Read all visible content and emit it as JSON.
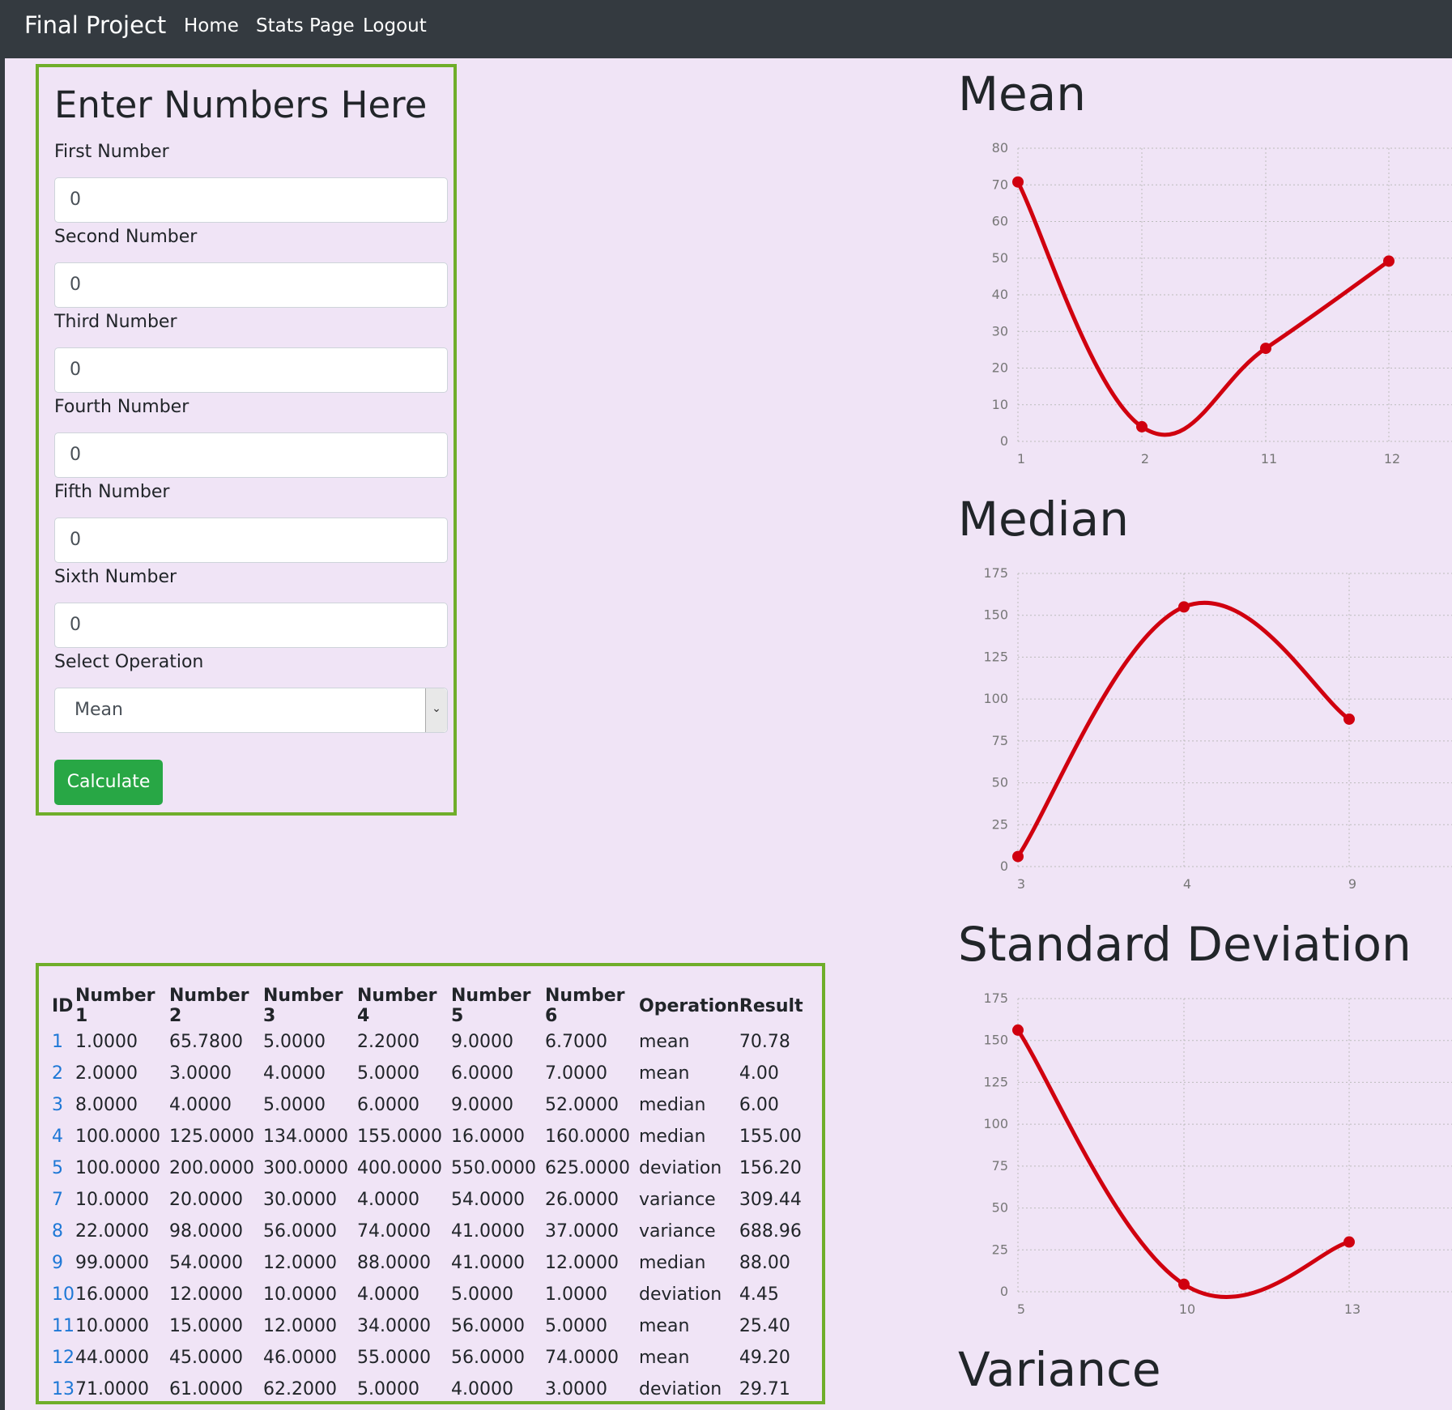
{
  "navbar": {
    "brand": "Final Project",
    "links": [
      "Home",
      "Stats Page",
      "Logout"
    ]
  },
  "form": {
    "title": "Enter Numbers Here",
    "fields": [
      {
        "label": "First Number",
        "value": "0"
      },
      {
        "label": "Second Number",
        "value": "0"
      },
      {
        "label": "Third Number",
        "value": "0"
      },
      {
        "label": "Fourth Number",
        "value": "0"
      },
      {
        "label": "Fifth Number",
        "value": "0"
      },
      {
        "label": "Sixth Number",
        "value": "0"
      }
    ],
    "operation_label": "Select Operation",
    "operation_value": "Mean",
    "submit_label": "Calculate"
  },
  "table": {
    "headers": [
      "ID",
      "Number 1",
      "Number 2",
      "Number 3",
      "Number 4",
      "Number 5",
      "Number 6",
      "Operation",
      "Result"
    ],
    "rows": [
      [
        "1",
        "1.0000",
        "65.7800",
        "5.0000",
        "2.2000",
        "9.0000",
        "6.7000",
        "mean",
        "70.78"
      ],
      [
        "2",
        "2.0000",
        "3.0000",
        "4.0000",
        "5.0000",
        "6.0000",
        "7.0000",
        "mean",
        "4.00"
      ],
      [
        "3",
        "8.0000",
        "4.0000",
        "5.0000",
        "6.0000",
        "9.0000",
        "52.0000",
        "median",
        "6.00"
      ],
      [
        "4",
        "100.0000",
        "125.0000",
        "134.0000",
        "155.0000",
        "16.0000",
        "160.0000",
        "median",
        "155.00"
      ],
      [
        "5",
        "100.0000",
        "200.0000",
        "300.0000",
        "400.0000",
        "550.0000",
        "625.0000",
        "deviation",
        "156.20"
      ],
      [
        "7",
        "10.0000",
        "20.0000",
        "30.0000",
        "4.0000",
        "54.0000",
        "26.0000",
        "variance",
        "309.44"
      ],
      [
        "8",
        "22.0000",
        "98.0000",
        "56.0000",
        "74.0000",
        "41.0000",
        "37.0000",
        "variance",
        "688.96"
      ],
      [
        "9",
        "99.0000",
        "54.0000",
        "12.0000",
        "88.0000",
        "41.0000",
        "12.0000",
        "median",
        "88.00"
      ],
      [
        "10",
        "16.0000",
        "12.0000",
        "10.0000",
        "4.0000",
        "5.0000",
        "1.0000",
        "deviation",
        "4.45"
      ],
      [
        "11",
        "10.0000",
        "15.0000",
        "12.0000",
        "34.0000",
        "56.0000",
        "5.0000",
        "mean",
        "25.40"
      ],
      [
        "12",
        "44.0000",
        "45.0000",
        "46.0000",
        "55.0000",
        "56.0000",
        "74.0000",
        "mean",
        "49.20"
      ],
      [
        "13",
        "71.0000",
        "61.0000",
        "62.2000",
        "5.0000",
        "4.0000",
        "3.0000",
        "deviation",
        "29.71"
      ]
    ]
  },
  "charts": {
    "titles": [
      "Mean",
      "Median",
      "Standard Deviation",
      "Variance"
    ]
  },
  "colors": {
    "line": "#d0000f",
    "accent_border": "#6fae2a",
    "button": "#28a745",
    "navbar": "#343a40",
    "page_bg": "#f0e4f6"
  },
  "chart_data": [
    {
      "type": "line",
      "title": "Mean",
      "categories": [
        "1",
        "2",
        "11",
        "12"
      ],
      "values": [
        70.78,
        4.0,
        25.4,
        49.2
      ],
      "yticks": [
        0,
        10,
        20,
        30,
        40,
        50,
        60,
        70,
        80
      ],
      "ylim": [
        0,
        80
      ],
      "grid": true
    },
    {
      "type": "line",
      "title": "Median",
      "categories": [
        "3",
        "4",
        "9"
      ],
      "values": [
        6.0,
        155.0,
        88.0
      ],
      "yticks": [
        0,
        25,
        50,
        75,
        100,
        125,
        150,
        175
      ],
      "ylim": [
        0,
        175
      ],
      "grid": true
    },
    {
      "type": "line",
      "title": "Standard Deviation",
      "categories": [
        "5",
        "10",
        "13"
      ],
      "values": [
        156.2,
        4.45,
        29.71
      ],
      "yticks": [
        0,
        25,
        50,
        75,
        100,
        125,
        150,
        175
      ],
      "ylim": [
        0,
        175
      ],
      "grid": true
    }
  ]
}
